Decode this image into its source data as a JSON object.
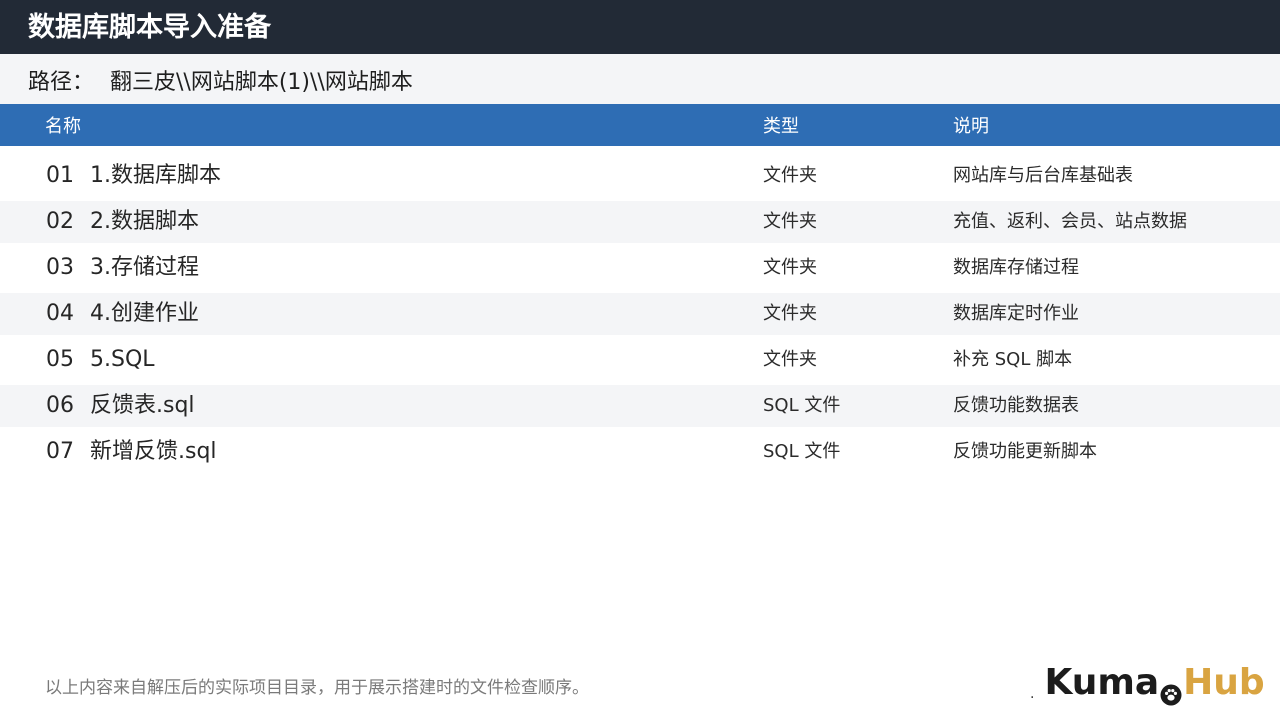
{
  "page": {
    "title": "数据库脚本导入准备"
  },
  "path": {
    "label": "路径：",
    "value": "翻三皮\\\\网站脚本(1)\\\\网站脚本"
  },
  "table": {
    "headers": {
      "name": "名称",
      "type": "类型",
      "desc": "说明"
    },
    "rows": [
      {
        "no": "01",
        "name": "1.数据库脚本",
        "type": "文件夹",
        "desc": "网站库与后台库基础表"
      },
      {
        "no": "02",
        "name": "2.数据脚本",
        "type": "文件夹",
        "desc": "充值、返利、会员、站点数据"
      },
      {
        "no": "03",
        "name": "3.存储过程",
        "type": "文件夹",
        "desc": "数据库存储过程"
      },
      {
        "no": "04",
        "name": "4.创建作业",
        "type": "文件夹",
        "desc": "数据库定时作业"
      },
      {
        "no": "05",
        "name": "5.SQL",
        "type": "文件夹",
        "desc": "补充 SQL 脚本"
      },
      {
        "no": "06",
        "name": "反馈表.sql",
        "type": "SQL 文件",
        "desc": "反馈功能数据表"
      },
      {
        "no": "07",
        "name": "新增反馈.sql",
        "type": "SQL 文件",
        "desc": "反馈功能更新脚本"
      }
    ]
  },
  "footer": {
    "note": "以上内容来自解压后的实际项目目录，用于展示搭建时的文件检查顺序。"
  },
  "logo": {
    "dot": ".",
    "part_a": "Kuma",
    "part_b": "Hub",
    "icon": "paw-icon"
  },
  "colors": {
    "title_bar": "#222a36",
    "header_blue": "#2e6db4",
    "row_alt": "#f4f5f7",
    "logo_gold": "#d9a441"
  }
}
